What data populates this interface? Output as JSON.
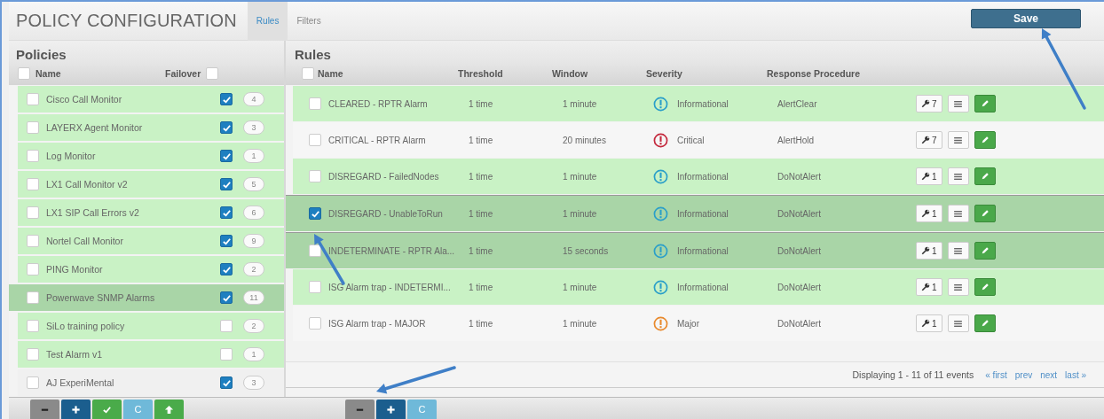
{
  "window": {
    "title": "POLICY CONFIGURATION"
  },
  "tabs": [
    {
      "label": "Rules",
      "selected": true
    },
    {
      "label": "Filters",
      "selected": false
    }
  ],
  "save_button": {
    "label": "Save"
  },
  "policies": {
    "title": "Policies",
    "columns": [
      "Name",
      "Failover"
    ],
    "select_all_checked": false,
    "failover_all_checked": false,
    "rows": [
      {
        "name": "Cisco Call Monitor",
        "checked": false,
        "failover": true,
        "count": "4",
        "active": true,
        "selected": false
      },
      {
        "name": "LAYERX Agent Monitor",
        "checked": false,
        "failover": true,
        "count": "3",
        "active": true,
        "selected": false
      },
      {
        "name": "Log Monitor",
        "checked": false,
        "failover": true,
        "count": "1",
        "active": true,
        "selected": false
      },
      {
        "name": "LX1 Call Monitor v2",
        "checked": false,
        "failover": true,
        "count": "5",
        "active": true,
        "selected": false
      },
      {
        "name": "LX1 SIP Call Errors v2",
        "checked": false,
        "failover": true,
        "count": "6",
        "active": true,
        "selected": false
      },
      {
        "name": "Nortel Call Monitor",
        "checked": false,
        "failover": true,
        "count": "9",
        "active": true,
        "selected": false
      },
      {
        "name": "PING Monitor",
        "checked": false,
        "failover": true,
        "count": "2",
        "active": true,
        "selected": false
      },
      {
        "name": "Powerwave SNMP Alarms",
        "checked": false,
        "failover": true,
        "count": "11",
        "active": true,
        "selected": true
      },
      {
        "name": "SiLo training policy",
        "checked": false,
        "failover": false,
        "count": "2",
        "active": true,
        "selected": false
      },
      {
        "name": "Test Alarm v1",
        "checked": false,
        "failover": false,
        "count": "1",
        "active": true,
        "selected": false
      },
      {
        "name": "AJ ExperiMental",
        "checked": false,
        "failover": true,
        "count": "3",
        "active": false,
        "selected": false
      }
    ]
  },
  "rules": {
    "title": "Rules",
    "columns": [
      "Name",
      "Threshold",
      "Window",
      "Severity",
      "Response Procedure"
    ],
    "select_all_checked": false,
    "rows": [
      {
        "name": "CLEARED - RPTR Alarm",
        "threshold": "1 time",
        "window": "1 minute",
        "severity": "Informational",
        "color": "#2a9fc9",
        "procedure": "AlertClear",
        "tools": "7",
        "checked": false,
        "active": true,
        "selected": false
      },
      {
        "name": "CRITICAL - RPTR Alarm",
        "threshold": "1 time",
        "window": "20 minutes",
        "severity": "Critical",
        "color": "#c4283c",
        "procedure": "AlertHold",
        "tools": "7",
        "checked": false,
        "active": false,
        "selected": false
      },
      {
        "name": "DISREGARD - FailedNodes",
        "threshold": "1 time",
        "window": "1 minute",
        "severity": "Informational",
        "color": "#2a9fc9",
        "procedure": "DoNotAlert",
        "tools": "1",
        "checked": false,
        "active": true,
        "selected": false
      },
      {
        "name": "DISREGARD - UnableToRun",
        "threshold": "1 time",
        "window": "1 minute",
        "severity": "Informational",
        "color": "#2a9fc9",
        "procedure": "DoNotAlert",
        "tools": "1",
        "checked": true,
        "active": true,
        "selected": true
      },
      {
        "name": "INDETERMINATE - RPTR Ala...",
        "threshold": "1 time",
        "window": "15 seconds",
        "severity": "Informational",
        "color": "#2a9fc9",
        "procedure": "DoNotAlert",
        "tools": "1",
        "checked": false,
        "active": true,
        "selected": true
      },
      {
        "name": "ISG Alarm trap - INDETERMI...",
        "threshold": "1 time",
        "window": "1 minute",
        "severity": "Informational",
        "color": "#2a9fc9",
        "procedure": "DoNotAlert",
        "tools": "1",
        "checked": false,
        "active": true,
        "selected": false
      },
      {
        "name": "ISG Alarm trap - MAJOR",
        "threshold": "1 time",
        "window": "1 minute",
        "severity": "Major",
        "color": "#e8892c",
        "procedure": "DoNotAlert",
        "tools": "1",
        "checked": false,
        "active": false,
        "selected": false
      }
    ],
    "pager": {
      "summary": "Displaying 1 - 11 of 11 events",
      "links": [
        "« first",
        "prev",
        "next",
        "last »"
      ]
    }
  },
  "policy_toolbar": [
    {
      "kind": "remove"
    },
    {
      "kind": "add"
    },
    {
      "kind": "check"
    },
    {
      "kind": "text",
      "label": "C"
    },
    {
      "kind": "upload"
    }
  ],
  "rule_toolbar": [
    {
      "kind": "remove"
    },
    {
      "kind": "add"
    },
    {
      "kind": "text",
      "label": "C"
    }
  ]
}
